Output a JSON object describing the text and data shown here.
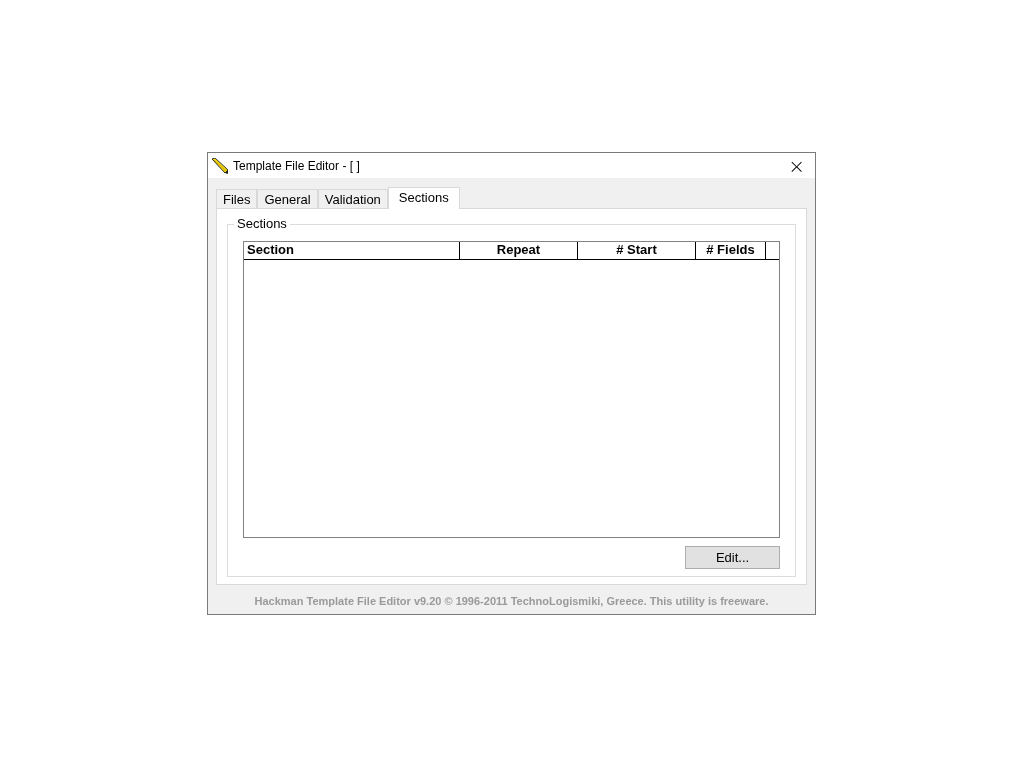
{
  "window": {
    "title": "Template File Editor - [ ]",
    "close": "×"
  },
  "tabs": [
    {
      "label": "Files",
      "selected": false
    },
    {
      "label": "General",
      "selected": false
    },
    {
      "label": "Validation",
      "selected": false
    },
    {
      "label": "Sections",
      "selected": true
    }
  ],
  "group": {
    "title": "Sections"
  },
  "table": {
    "columns": [
      {
        "label": "Section"
      },
      {
        "label": "Repeat"
      },
      {
        "label": "# Start"
      },
      {
        "label": "# Fields"
      }
    ]
  },
  "buttons": [
    "Edit..."
  ],
  "status_bar": "Hackman Template File Editor v9.20 © 1996-2011 TechnoLogismiki, Greece. This utility is freeware."
}
